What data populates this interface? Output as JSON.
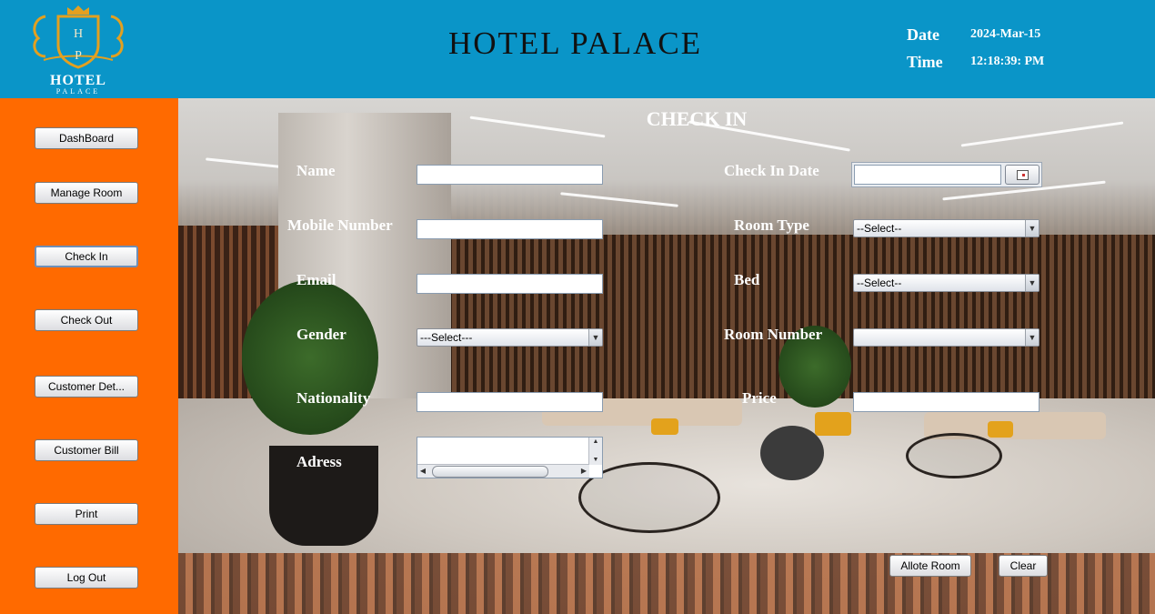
{
  "header": {
    "logo_initials": "H P",
    "logo_word": "HOTEL",
    "logo_sub": "PALACE",
    "title": "HOTEL PALACE",
    "date_label": "Date",
    "date_value": "2024-Mar-15",
    "time_label": "Time",
    "time_value": "12:18:39: PM"
  },
  "sidebar": {
    "items": [
      {
        "label": "DashBoard"
      },
      {
        "label": "Manage Room"
      },
      {
        "label": "Check In"
      },
      {
        "label": "Check Out"
      },
      {
        "label": "Customer Det..."
      },
      {
        "label": "Customer Bill"
      },
      {
        "label": "Print"
      },
      {
        "label": "Log Out"
      }
    ]
  },
  "form": {
    "title": "CHECK IN",
    "labels": {
      "name": "Name",
      "mobile": "Mobile Number",
      "email": "Email",
      "gender": "Gender",
      "nationality": "Nationality",
      "address": "Adress",
      "check_in_date": "Check In Date",
      "room_type": "Room Type",
      "bed": "Bed",
      "room_number": "Room Number",
      "price": "Price"
    },
    "values": {
      "name": "",
      "mobile": "",
      "email": "",
      "nationality": "",
      "address": "",
      "check_in_date": "",
      "price": ""
    },
    "selects": {
      "gender": "---Select---",
      "room_type": "--Select--",
      "bed": "--Select--",
      "room_number": ""
    }
  },
  "actions": {
    "allot_label": "Allote Room",
    "clear_label": "Clear"
  },
  "colors": {
    "header_bg": "#0a95c8",
    "sidebar_bg": "#ff6a00",
    "label_text": "#ffffff"
  }
}
